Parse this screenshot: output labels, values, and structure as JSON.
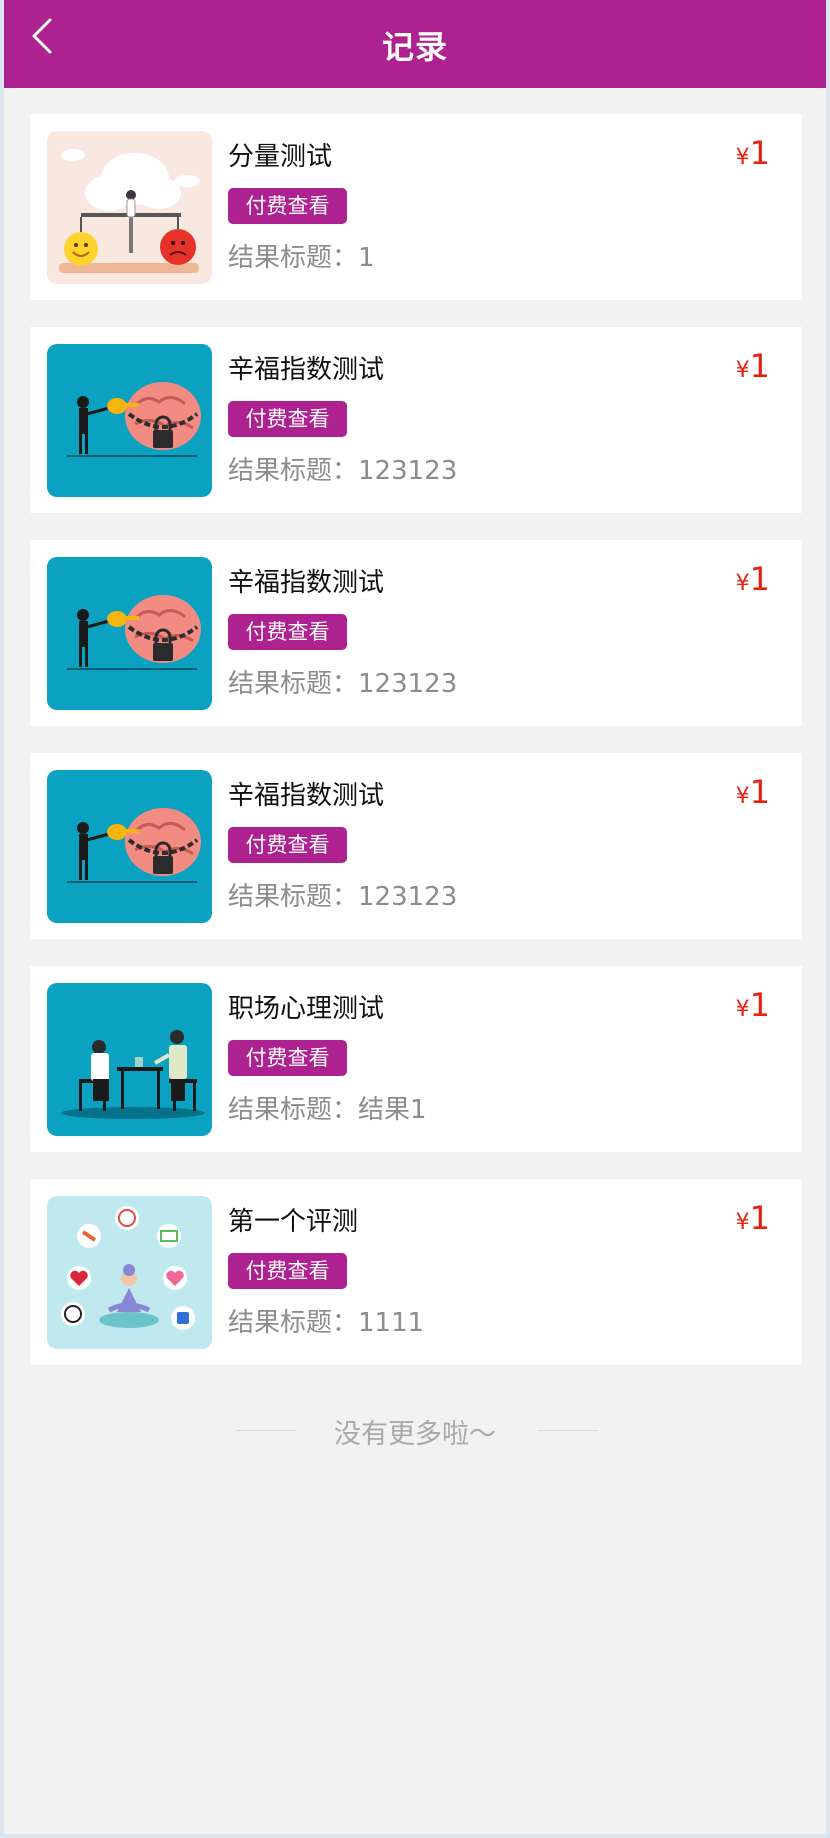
{
  "header": {
    "title": "记录",
    "back_icon": "chevron-left-icon"
  },
  "records": [
    {
      "title": "分量测试",
      "currency": "¥",
      "price": "1",
      "pay_label": "付费查看",
      "result": "结果标题：1",
      "thumb": "balance-illustration"
    },
    {
      "title": "辛福指数测试",
      "currency": "¥",
      "price": "1",
      "pay_label": "付费查看",
      "result": "结果标题：123123",
      "thumb": "brain-lock-illustration"
    },
    {
      "title": "辛福指数测试",
      "currency": "¥",
      "price": "1",
      "pay_label": "付费查看",
      "result": "结果标题：123123",
      "thumb": "brain-lock-illustration"
    },
    {
      "title": "辛福指数测试",
      "currency": "¥",
      "price": "1",
      "pay_label": "付费查看",
      "result": "结果标题：123123",
      "thumb": "brain-lock-illustration"
    },
    {
      "title": "职场心理测试",
      "currency": "¥",
      "price": "1",
      "pay_label": "付费查看",
      "result": "结果标题：结果1",
      "thumb": "office-meeting-illustration"
    },
    {
      "title": "第一个评测",
      "currency": "¥",
      "price": "1",
      "pay_label": "付费查看",
      "result": "结果标题：1111",
      "thumb": "wellness-meditation-illustration"
    }
  ],
  "footer": {
    "no_more": "没有更多啦～"
  },
  "colors": {
    "accent": "#ae2190",
    "price": "#e8220f",
    "background": "#f2f2f2",
    "thumb_teal": "#0aa2c0"
  }
}
